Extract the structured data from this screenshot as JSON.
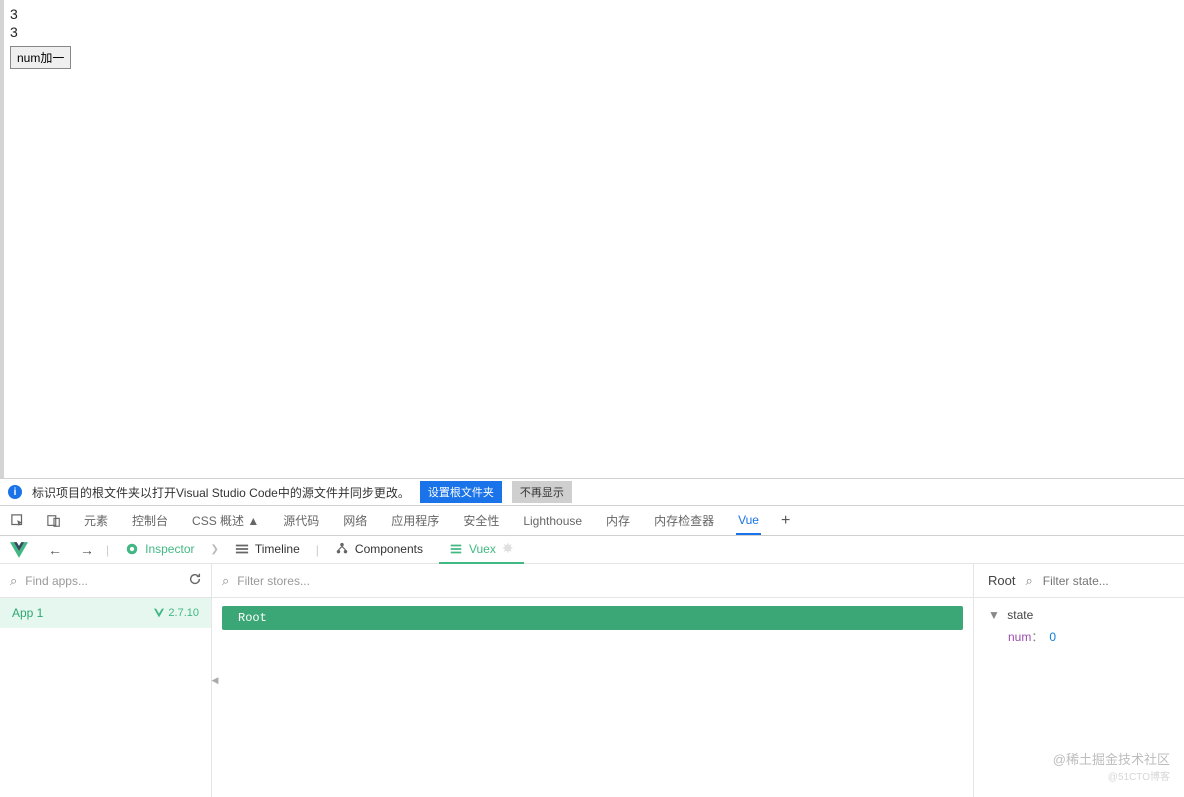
{
  "page": {
    "num1": "3",
    "num2": "3",
    "button_label": "num加一"
  },
  "info_bar": {
    "text": "标识项目的根文件夹以打开Visual Studio Code中的源文件并同步更改。",
    "set_folder": "设置根文件夹",
    "dismiss": "不再显示"
  },
  "devtools_tabs": [
    "元素",
    "控制台",
    "CSS 概述 ▲",
    "源代码",
    "网络",
    "应用程序",
    "安全性",
    "Lighthouse",
    "内存",
    "内存检查器",
    "Vue"
  ],
  "devtools_active_index": 10,
  "vue_tabs": {
    "inspector": "Inspector",
    "timeline": "Timeline",
    "components": "Components",
    "vuex": "Vuex"
  },
  "panel_a": {
    "search_placeholder": "Find apps...",
    "app_name": "App 1",
    "app_version": "2.7.10"
  },
  "panel_b": {
    "search_placeholder": "Filter stores...",
    "root": "Root"
  },
  "panel_c": {
    "title": "Root",
    "search_placeholder": "Filter state...",
    "state_label": "state",
    "key": "num",
    "colon": "：",
    "value": "0"
  },
  "watermark": {
    "line1": "@稀土掘金技术社区",
    "line2": "@51CTO博客"
  }
}
